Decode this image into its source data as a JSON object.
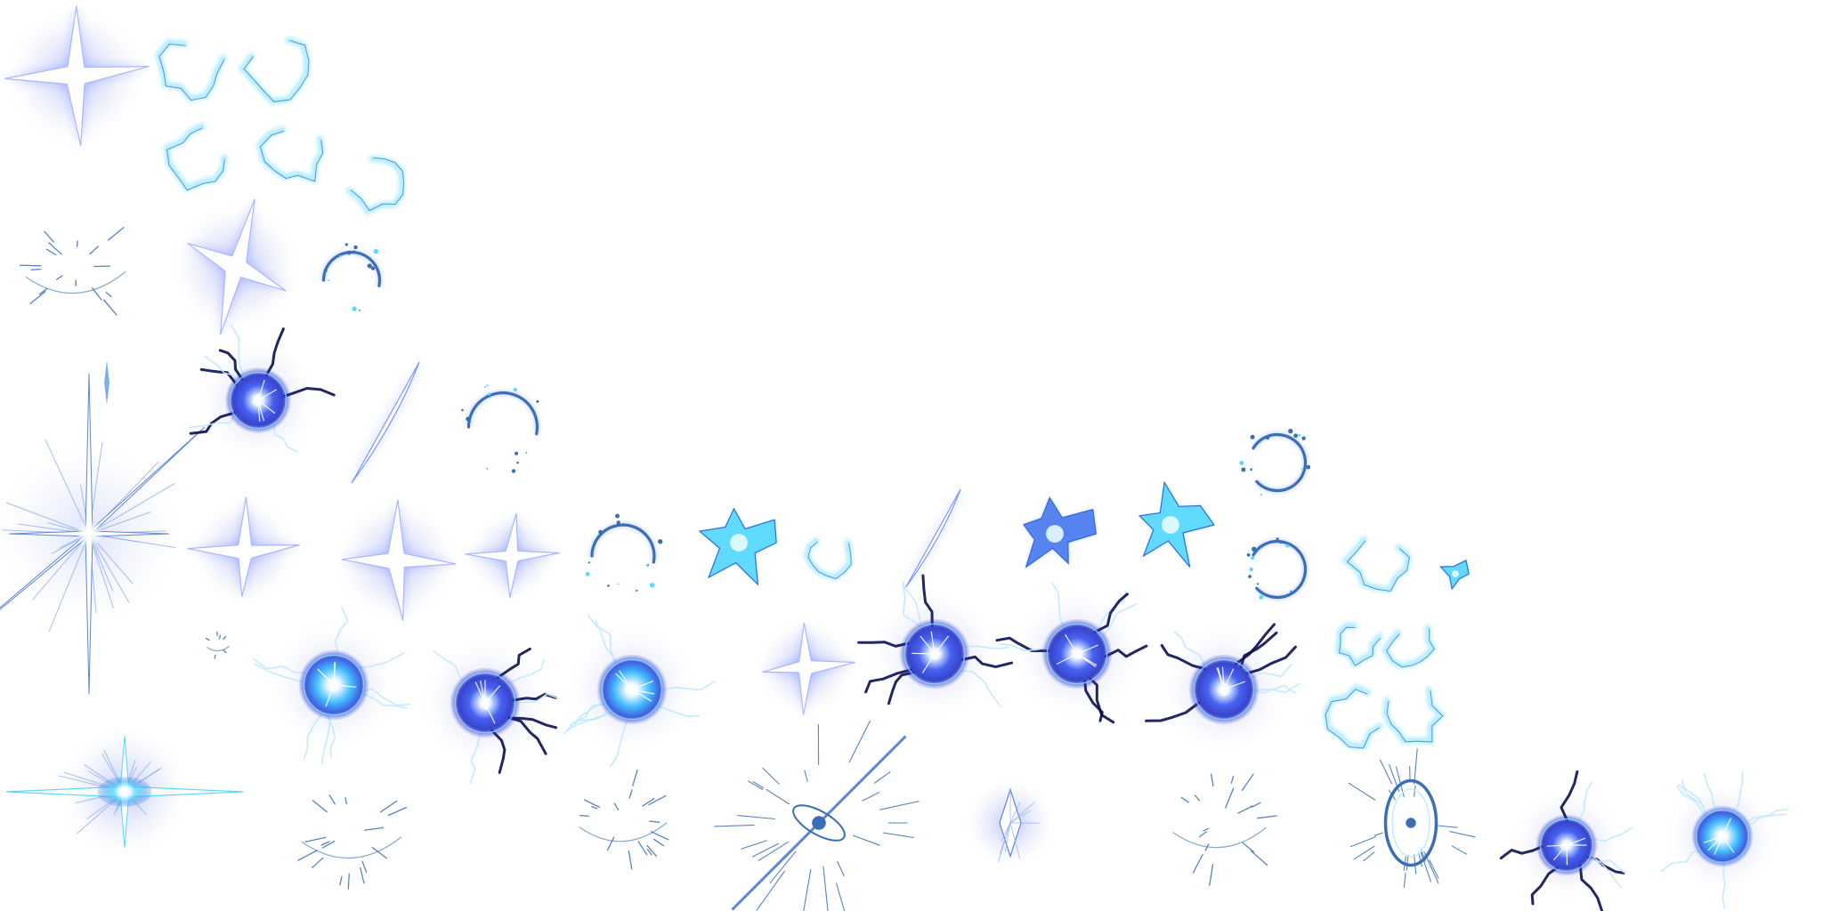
{
  "sheet": {
    "background": "#ffffff",
    "palette": {
      "core": "#ffffff",
      "glow": "#7f95ff",
      "cyan": "#59d8ff",
      "ice": "#bfefff",
      "deep": "#2431c7",
      "ink": "#0b1050",
      "line": "#3a6fb5",
      "halo": "#c7cdf0"
    }
  },
  "sprites": [
    {
      "name": "sprite-star-burst-1",
      "kind": "star4",
      "variant": "soft"
    },
    {
      "name": "sprite-arc-fragment-1",
      "kind": "arc",
      "variant": "cyan"
    },
    {
      "name": "sprite-arc-fragment-2",
      "kind": "arc",
      "variant": "cyan"
    },
    {
      "name": "sprite-arc-fragment-3",
      "kind": "arc",
      "variant": "cyan"
    },
    {
      "name": "sprite-arc-fragment-4",
      "kind": "arc",
      "variant": "cyan"
    },
    {
      "name": "sprite-arc-fragment-5",
      "kind": "arc",
      "variant": "cyan"
    },
    {
      "name": "sprite-debris-streaks-1",
      "kind": "debris",
      "variant": "thin"
    },
    {
      "name": "sprite-star-burst-2",
      "kind": "star4",
      "variant": "soft"
    },
    {
      "name": "sprite-ring-1",
      "kind": "ring",
      "variant": "blue"
    },
    {
      "name": "sprite-needle-1",
      "kind": "needle",
      "variant": "blue"
    },
    {
      "name": "sprite-lens-flare-1",
      "kind": "flare",
      "variant": "tall"
    },
    {
      "name": "sprite-energy-orb-1",
      "kind": "orb",
      "variant": "dark"
    },
    {
      "name": "sprite-slash-1",
      "kind": "slash",
      "variant": "blue"
    },
    {
      "name": "sprite-ring-2",
      "kind": "ring",
      "variant": "blue"
    },
    {
      "name": "sprite-star-burst-3",
      "kind": "star4",
      "variant": "soft"
    },
    {
      "name": "sprite-star-burst-4",
      "kind": "star4",
      "variant": "soft"
    },
    {
      "name": "sprite-star-burst-5",
      "kind": "star4",
      "variant": "soft"
    },
    {
      "name": "sprite-ring-3",
      "kind": "ring",
      "variant": "blue"
    },
    {
      "name": "sprite-shard-1",
      "kind": "shard",
      "variant": "cyan"
    },
    {
      "name": "sprite-arc-fragment-6",
      "kind": "arc",
      "variant": "cyan"
    },
    {
      "name": "sprite-slash-2",
      "kind": "slash",
      "variant": "blue"
    },
    {
      "name": "sprite-shard-2",
      "kind": "shard",
      "variant": "blue"
    },
    {
      "name": "sprite-shard-3",
      "kind": "shard",
      "variant": "cyan"
    },
    {
      "name": "sprite-ring-4",
      "kind": "ring",
      "variant": "open"
    },
    {
      "name": "sprite-ring-5",
      "kind": "ring",
      "variant": "open"
    },
    {
      "name": "sprite-arc-fragment-7",
      "kind": "arc",
      "variant": "cyan"
    },
    {
      "name": "sprite-shard-4",
      "kind": "shard",
      "variant": "small"
    },
    {
      "name": "sprite-spark-dots-1",
      "kind": "debris",
      "variant": "dots"
    },
    {
      "name": "sprite-energy-orb-2",
      "kind": "orb",
      "variant": "bright"
    },
    {
      "name": "sprite-energy-orb-3",
      "kind": "orb",
      "variant": "dark"
    },
    {
      "name": "sprite-energy-orb-4",
      "kind": "orb",
      "variant": "bright"
    },
    {
      "name": "sprite-star-burst-6",
      "kind": "star4",
      "variant": "soft"
    },
    {
      "name": "sprite-energy-orb-5",
      "kind": "orb",
      "variant": "dark"
    },
    {
      "name": "sprite-energy-orb-6",
      "kind": "orb",
      "variant": "dark"
    },
    {
      "name": "sprite-energy-orb-7",
      "kind": "orb",
      "variant": "dark"
    },
    {
      "name": "sprite-arc-fragment-8",
      "kind": "arc",
      "variant": "cyan"
    },
    {
      "name": "sprite-arc-fragment-9",
      "kind": "arc",
      "variant": "cyan"
    },
    {
      "name": "sprite-arc-fragment-10",
      "kind": "arc",
      "variant": "cyan"
    },
    {
      "name": "sprite-arc-fragment-11",
      "kind": "arc",
      "variant": "cyan"
    },
    {
      "name": "sprite-lens-flare-2",
      "kind": "flare",
      "variant": "wide"
    },
    {
      "name": "sprite-debris-streaks-2",
      "kind": "debris",
      "variant": "thin"
    },
    {
      "name": "sprite-debris-streaks-3",
      "kind": "debris",
      "variant": "thin"
    },
    {
      "name": "sprite-portal-streak-1",
      "kind": "portal",
      "variant": "diagonal"
    },
    {
      "name": "sprite-diamond-flare-1",
      "kind": "diamond",
      "variant": "glow"
    },
    {
      "name": "sprite-debris-streaks-4",
      "kind": "debris",
      "variant": "thin"
    },
    {
      "name": "sprite-portal-ring-1",
      "kind": "portal",
      "variant": "oval"
    },
    {
      "name": "sprite-energy-orb-8",
      "kind": "orb",
      "variant": "dark"
    },
    {
      "name": "sprite-energy-orb-9",
      "kind": "orb",
      "variant": "bright"
    }
  ]
}
